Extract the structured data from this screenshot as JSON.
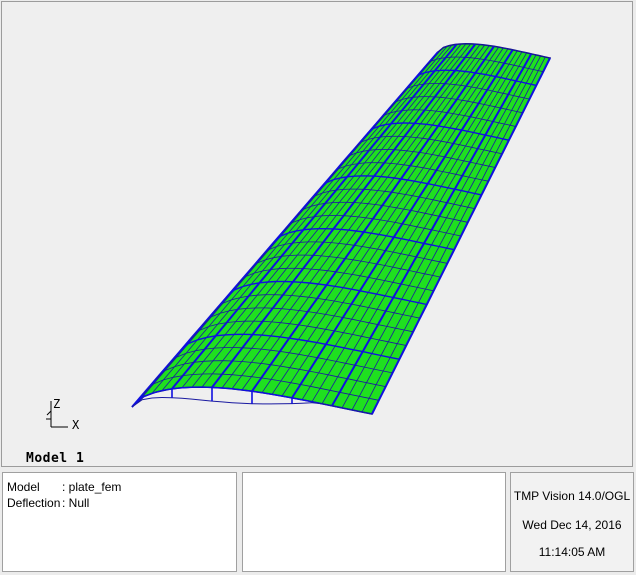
{
  "viewport": {
    "axis": {
      "z_label": "Z",
      "x_label": "X"
    },
    "model_label": "Model 1",
    "mesh_colors": {
      "fill": "#1fe01f",
      "grid": "#1a1aa0",
      "spar": "#1010e0",
      "outline": "#101080"
    }
  },
  "info_panel": {
    "rows": [
      {
        "key": "Model",
        "value": ": plate_fem"
      },
      {
        "key": "Deflection",
        "value": ": Null"
      }
    ]
  },
  "status_panel": {
    "version": "TMP Vision 14.0/OGL",
    "date": "Wed Dec 14, 2016",
    "time": "11:14:05 AM"
  }
}
